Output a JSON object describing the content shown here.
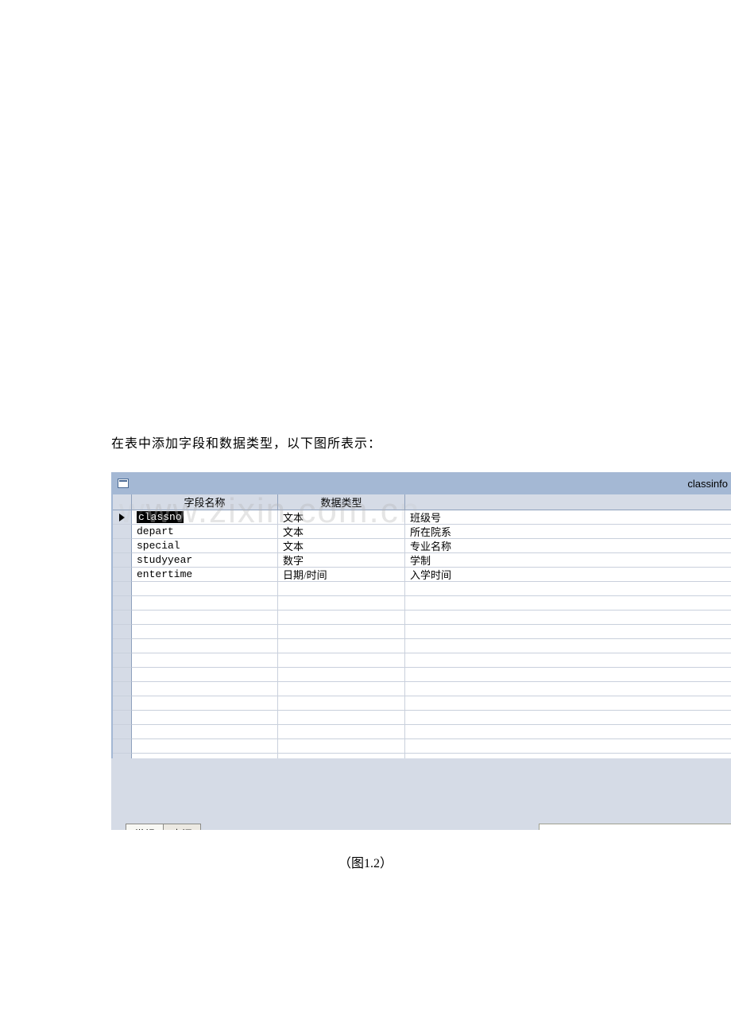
{
  "captionAbove": "在表中添加字段和数据类型，以下图所表示：",
  "windowTitle": "classinfo",
  "headers": {
    "fieldName": "字段名称",
    "dataType": "数据类型"
  },
  "rows": [
    {
      "name": "classno",
      "type": "文本",
      "desc": "班级号",
      "selected": true
    },
    {
      "name": "depart",
      "type": "文本",
      "desc": "所在院系",
      "selected": false
    },
    {
      "name": "special",
      "type": "文本",
      "desc": "专业名称",
      "selected": false
    },
    {
      "name": "studyyear",
      "type": "数字",
      "desc": "学制",
      "selected": false
    },
    {
      "name": "entertime",
      "type": "日期/时间",
      "desc": "入学时间",
      "selected": false
    }
  ],
  "emptyRowsCount": 13,
  "tabs": {
    "active": "常规",
    "inactive": "查阅"
  },
  "figureCaption": "（图1.2）",
  "watermark": "www.zixin.com.cn"
}
